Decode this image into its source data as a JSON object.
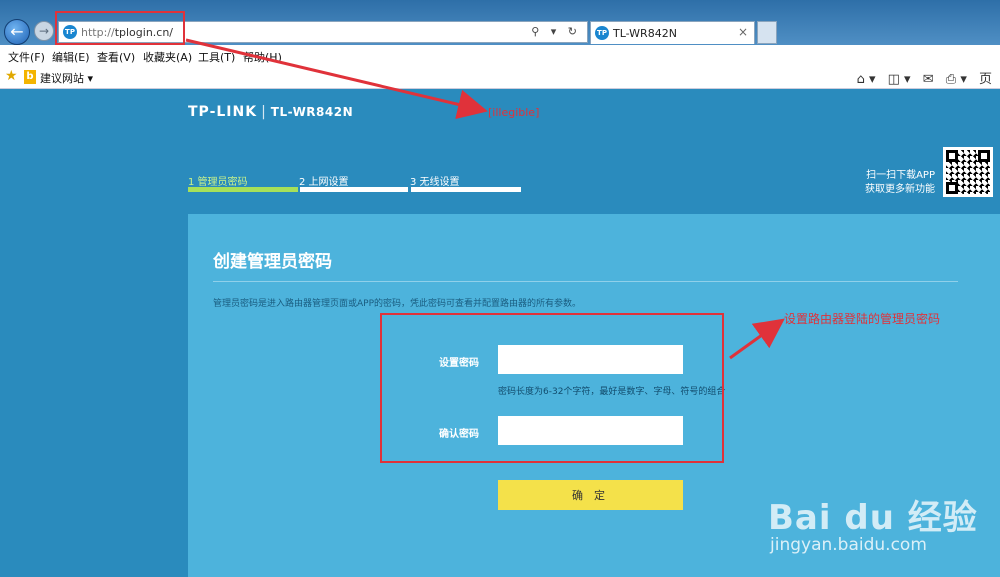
{
  "browser": {
    "url_scheme": "http://",
    "url_host": "tplogin.cn/",
    "site_icon": "TP",
    "addr_controls": "⚲ ▾ ↻",
    "tab_title": "TL-WR842N",
    "tab_close": "×",
    "back_icon": "←",
    "forward_icon": "→",
    "menu": [
      "文件(F)",
      "编辑(E)",
      "查看(V)",
      "收藏夹(A)",
      "工具(T)",
      "帮助(H)"
    ],
    "favorites_link": "建议网站 ▾",
    "cmd_icons": [
      "⌂ ▾",
      "◫ ▾",
      "✉",
      "⎙ ▾",
      "页"
    ]
  },
  "page": {
    "logo_brand": "TP-LINK",
    "logo_sep": "|",
    "logo_model": "TL-WR842N",
    "steps": [
      {
        "label": "1 管理员密码",
        "active": true
      },
      {
        "label": "2 上网设置",
        "active": false
      },
      {
        "label": "3 无线设置",
        "active": false
      }
    ],
    "app_line1": "扫一扫下载APP",
    "app_line2": "获取更多新功能",
    "panel": {
      "title": "创建管理员密码",
      "description": "管理员密码是进入路由器管理页面或APP的密码，凭此密码可查看并配置路由器的所有参数。",
      "password_label": "设置密码",
      "password_value": "",
      "password_hint": "密码长度为6-32个字符，最好是数字、字母、符号的组合",
      "confirm_label": "确认密码",
      "confirm_value": "",
      "confirm_button": "确 定"
    }
  },
  "annotations": {
    "url_note": "[illegible]",
    "password_note": "设置路由器登陆的管理员密码",
    "color": "#e0323a"
  },
  "watermark": {
    "logo": "Bai du 经验",
    "url": "jingyan.baidu.com"
  }
}
